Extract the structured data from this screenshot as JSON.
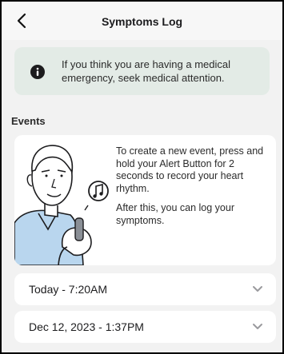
{
  "header": {
    "title": "Symptoms Log",
    "back_icon": "chevron-left-icon"
  },
  "alert": {
    "icon": "info-icon",
    "message": "If you think you are having a medical emergency, seek medical attention.",
    "background": "#e3ebe6"
  },
  "events": {
    "section_label": "Events",
    "instructions": "To create a new event, press and hold your Alert Button for 2 seconds to record your heart rhythm.",
    "followup": "After this, you can log your symptoms.",
    "illustration": "man-holding-alert-button-illustration",
    "items": [
      {
        "label": "Today - 7:20AM",
        "icon": "chevron-down-icon"
      },
      {
        "label": "Dec 12, 2023 - 1:37PM",
        "icon": "chevron-down-icon"
      }
    ]
  },
  "colors": {
    "accent_blue": "#b9d6ee",
    "background": "#f2f2f2",
    "card": "#ffffff"
  }
}
